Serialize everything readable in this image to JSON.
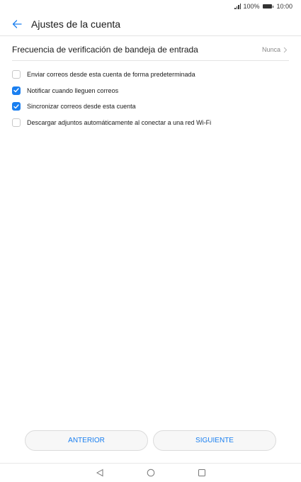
{
  "status_bar": {
    "battery_text": "100%",
    "time": "10:00"
  },
  "header": {
    "title": "Ajustes de la cuenta",
    "back_icon": "arrow-left-icon"
  },
  "frequency": {
    "label": "Frecuencia de verificación de bandeja de entrada",
    "value": "Nunca"
  },
  "options": [
    {
      "label": "Enviar correos desde esta cuenta de forma predeterminada",
      "checked": false
    },
    {
      "label": "Notificar cuando lleguen correos",
      "checked": true
    },
    {
      "label": "Sincronizar correos desde esta cuenta",
      "checked": true
    },
    {
      "label": "Descargar adjuntos automáticamente al conectar a una red Wi-Fi",
      "checked": false
    }
  ],
  "buttons": {
    "previous": "ANTERIOR",
    "next": "SIGUIENTE"
  },
  "colors": {
    "accent": "#1a7ff0"
  }
}
